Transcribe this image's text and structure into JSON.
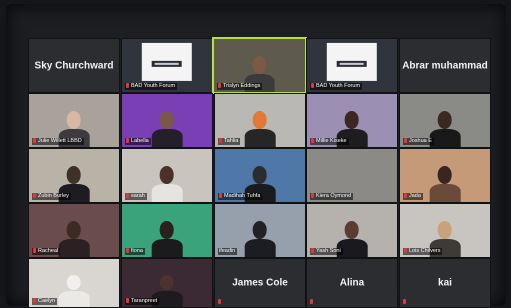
{
  "theme": {
    "active_speaker_border": "#b6e23c",
    "muted_mic": "#e0383e",
    "tile_background": "#2a2d33"
  },
  "participants": [
    {
      "id": "sky",
      "name": "Sky Churchward",
      "video": false
    },
    {
      "id": "bad1",
      "name": "BAD Youth Forum",
      "video": true,
      "logo": true,
      "muted": true
    },
    {
      "id": "trislyn",
      "name": "Trislyn Eddings",
      "video": true,
      "active": true,
      "muted": true
    },
    {
      "id": "bad2",
      "name": "BAD Youth Forum",
      "video": true,
      "logo": true,
      "muted": true
    },
    {
      "id": "abrar",
      "name": "Abrar muhammad",
      "video": false
    },
    {
      "id": "julie",
      "name": "Julie Willett LBBD",
      "video": true,
      "muted": true
    },
    {
      "id": "labella",
      "name": "Labella",
      "video": true,
      "muted": true
    },
    {
      "id": "tahlia",
      "name": "Tahlia",
      "video": true,
      "muted": true
    },
    {
      "id": "millie",
      "name": "Millie Kiseke",
      "video": true,
      "muted": true
    },
    {
      "id": "joshua",
      "name": "Joshua E",
      "video": true,
      "muted": true
    },
    {
      "id": "zubin",
      "name": "Zubin Burley",
      "video": true,
      "muted": true
    },
    {
      "id": "sarah",
      "name": "sarah",
      "video": true,
      "muted": true
    },
    {
      "id": "madihah",
      "name": "Madihah Tuhfa",
      "video": true,
      "muted": true
    },
    {
      "id": "kiera",
      "name": "Kiera Oymond",
      "video": true,
      "muted": true
    },
    {
      "id": "jada",
      "name": "Jada",
      "video": true,
      "muted": true
    },
    {
      "id": "racheal",
      "name": "Racheal",
      "video": true,
      "muted": true
    },
    {
      "id": "fiona",
      "name": "fiona",
      "video": true,
      "muted": true
    },
    {
      "id": "ifeadin",
      "name": "ifeadin",
      "video": true,
      "muted": false
    },
    {
      "id": "yash",
      "name": "Yash Soni",
      "video": true,
      "muted": true
    },
    {
      "id": "lois",
      "name": "Lois Chilvers",
      "video": true,
      "muted": true
    },
    {
      "id": "caelyn",
      "name": "Caelyn",
      "video": true,
      "muted": true
    },
    {
      "id": "taranpreet",
      "name": "Taranpreet",
      "video": true,
      "muted": true
    },
    {
      "id": "james",
      "name": "James Cole",
      "video": false,
      "muted": true
    },
    {
      "id": "alina",
      "name": "Alina",
      "video": false,
      "muted": true
    },
    {
      "id": "kai",
      "name": "kai",
      "video": false,
      "muted": true
    }
  ]
}
